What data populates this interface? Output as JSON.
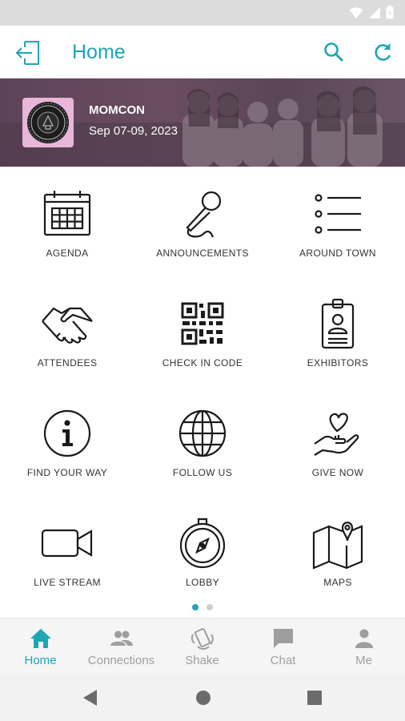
{
  "app_bar": {
    "title": "Home"
  },
  "event": {
    "name": "MOMCON",
    "dates": "Sep 07-09, 2023"
  },
  "tiles": [
    {
      "label": "AGENDA",
      "icon": "calendar-icon"
    },
    {
      "label": "ANNOUNCEMENTS",
      "icon": "microphone-icon"
    },
    {
      "label": "AROUND TOWN",
      "icon": "list-icon"
    },
    {
      "label": "ATTENDEES",
      "icon": "handshake-icon"
    },
    {
      "label": "CHECK IN CODE",
      "icon": "qr-code-icon"
    },
    {
      "label": "EXHIBITORS",
      "icon": "id-badge-icon"
    },
    {
      "label": "FIND YOUR WAY",
      "icon": "info-icon"
    },
    {
      "label": "FOLLOW US",
      "icon": "globe-icon"
    },
    {
      "label": "GIVE NOW",
      "icon": "heart-hand-icon"
    },
    {
      "label": "LIVE STREAM",
      "icon": "video-camera-icon"
    },
    {
      "label": "LOBBY",
      "icon": "compass-icon"
    },
    {
      "label": "MAPS",
      "icon": "map-icon"
    }
  ],
  "pager": {
    "current_page": 1,
    "total_pages": 2
  },
  "tabs": [
    {
      "label": "Home",
      "icon": "home-icon",
      "active": true
    },
    {
      "label": "Connections",
      "icon": "people-icon",
      "active": false
    },
    {
      "label": "Shake",
      "icon": "shake-phone-icon",
      "active": false
    },
    {
      "label": "Chat",
      "icon": "chat-bubble-icon",
      "active": false
    },
    {
      "label": "Me",
      "icon": "person-icon",
      "active": false
    }
  ],
  "colors": {
    "accent": "#1fa6b4",
    "inactive": "#9e9e9e",
    "icon_stroke": "#1a1a1a",
    "banner": "#5e4358"
  }
}
